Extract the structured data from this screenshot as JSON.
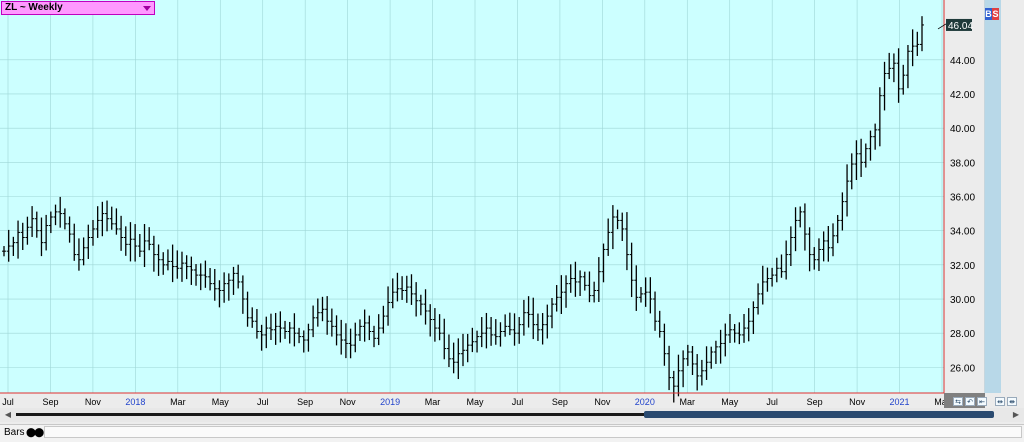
{
  "symbol_label": "ZL ~ Weekly",
  "last_price_label": "46.04",
  "bs_buttons": {
    "buy": "B",
    "sell": "S"
  },
  "status_bar": {
    "mode_label": "Bars"
  },
  "colors": {
    "plot_bg": "#ccffff",
    "bars": "#000000",
    "frame_red": "#e03030",
    "year_label": "#2244cc"
  },
  "chart_data": {
    "type": "ohlc",
    "title": "ZL ~ Weekly",
    "ylim": [
      24.5,
      47.5
    ],
    "y_ticks": [
      "26.00",
      "28.00",
      "30.00",
      "32.00",
      "34.00",
      "36.00",
      "38.00",
      "40.00",
      "42.00",
      "44.00",
      "46.04"
    ],
    "x_labels": [
      "Jul",
      "Sep",
      "Nov",
      "2018",
      "Mar",
      "May",
      "Jul",
      "Sep",
      "Nov",
      "2019",
      "Mar",
      "May",
      "Jul",
      "Sep",
      "Nov",
      "2020",
      "Mar",
      "May",
      "Jul",
      "Sep",
      "Nov",
      "2021",
      "Mar"
    ],
    "grid": true,
    "last_value": 46.04,
    "values": [
      32.8,
      33.1,
      33.3,
      33.9,
      33.6,
      34.2,
      34.7,
      34.0,
      33.3,
      34.3,
      34.8,
      35.1,
      35.0,
      34.4,
      33.8,
      32.6,
      32.3,
      33.0,
      33.6,
      34.1,
      34.6,
      35.0,
      34.7,
      34.4,
      34.1,
      33.6,
      33.2,
      33.5,
      33.1,
      32.8,
      33.4,
      33.2,
      32.6,
      32.3,
      32.0,
      32.2,
      31.9,
      31.8,
      32.1,
      31.9,
      31.7,
      31.4,
      31.4,
      31.3,
      30.9,
      30.6,
      30.5,
      30.9,
      31.1,
      31.5,
      31.0,
      30.0,
      28.9,
      28.7,
      28.1,
      27.9,
      28.3,
      28.2,
      28.4,
      28.3,
      28.1,
      28.3,
      28.0,
      27.8,
      27.6,
      28.2,
      28.9,
      29.2,
      29.4,
      28.7,
      28.4,
      27.9,
      27.6,
      27.4,
      27.3,
      27.9,
      28.4,
      28.6,
      28.1,
      27.7,
      28.3,
      29.0,
      29.8,
      30.4,
      30.6,
      30.5,
      30.7,
      30.3,
      29.9,
      29.7,
      29.3,
      28.8,
      28.3,
      28.0,
      27.1,
      26.5,
      26.3,
      26.8,
      27.0,
      27.3,
      27.5,
      27.8,
      28.0,
      28.3,
      27.9,
      27.8,
      28.1,
      28.4,
      28.2,
      28.0,
      28.5,
      29.2,
      29.1,
      28.5,
      28.2,
      28.5,
      29.0,
      29.7,
      30.1,
      30.4,
      30.9,
      31.2,
      31.0,
      31.3,
      30.8,
      30.2,
      30.5,
      31.6,
      32.9,
      33.9,
      34.8,
      34.6,
      34.1,
      32.6,
      31.1,
      30.1,
      30.3,
      30.4,
      30.0,
      28.7,
      28.1,
      26.8,
      25.4,
      24.9,
      25.8,
      26.5,
      26.9,
      26.2,
      25.5,
      25.8,
      26.3,
      26.9,
      27.2,
      27.4,
      27.9,
      28.2,
      28.0,
      27.9,
      28.3,
      28.7,
      29.5,
      30.3,
      31.0,
      31.2,
      31.4,
      31.8,
      31.6,
      32.6,
      33.6,
      34.6,
      35.1,
      33.8,
      32.6,
      32.3,
      32.9,
      33.4,
      33.0,
      33.7,
      34.6,
      35.7,
      36.9,
      37.9,
      38.5,
      38.0,
      38.8,
      39.5,
      39.9,
      41.9,
      43.2,
      43.5,
      43.8,
      42.3,
      43.1,
      44.5,
      44.8,
      44.9,
      46.04
    ]
  }
}
